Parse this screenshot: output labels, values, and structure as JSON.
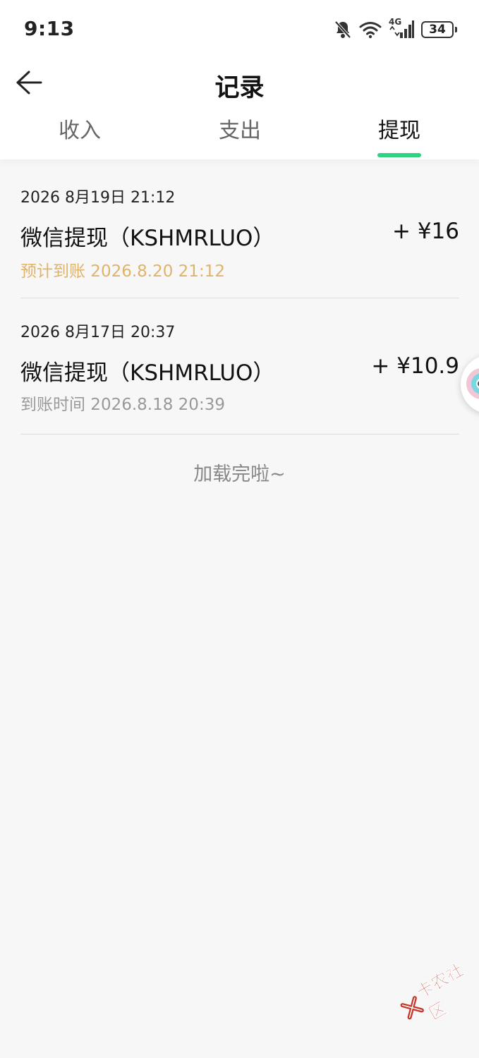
{
  "status_bar": {
    "time": "9:13",
    "network_label": "4G",
    "battery_level": "34"
  },
  "header": {
    "title": "记录",
    "tabs": [
      {
        "label": "收入",
        "active": false
      },
      {
        "label": "支出",
        "active": false
      },
      {
        "label": "提现",
        "active": true
      }
    ],
    "accent_color": "#2ed37f"
  },
  "records": [
    {
      "date": "2026 8月19日 21:12",
      "title": "微信提现（KSHMRLUO）",
      "amount": "+ ¥16",
      "sub": "预计到账 2026.8.20 21:12",
      "sub_color": "#e0b36a"
    },
    {
      "date": "2026 8月17日 20:37",
      "title": "微信提现（KSHMRLUO）",
      "amount": "+ ¥10.9",
      "sub": "到账时间 2026.8.18 20:39",
      "sub_color": "#999999"
    }
  ],
  "load_end_text": "加载完啦~",
  "watermark": {
    "text": "卡农社区",
    "icon": "kanong-logo-icon"
  },
  "icons": {
    "back": "arrow-left-icon",
    "mute": "bell-off-icon",
    "wifi": "wifi-icon",
    "signal": "signal-icon",
    "battery": "battery-icon",
    "float_widget": "floating-assistant-icon"
  }
}
